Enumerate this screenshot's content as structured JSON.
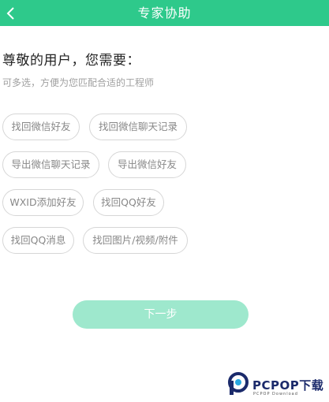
{
  "header": {
    "title": "专家协助",
    "back_icon": "chevron-left-icon",
    "color": "#2ec98b"
  },
  "greeting": "尊敬的用户，您需要：",
  "hint": "可多选，方便为您匹配合适的工程师",
  "options": [
    "找回微信好友",
    "找回微信聊天记录",
    "导出微信聊天记录",
    "导出微信好友",
    "WXID添加好友",
    "找回QQ好友",
    "找回QQ消息",
    "找回图片/视频/附件"
  ],
  "next_button": {
    "label": "下一步",
    "color": "#9ee8cd"
  },
  "watermark": {
    "main": "PCPOP下载",
    "sub": "PCPOP Download"
  }
}
